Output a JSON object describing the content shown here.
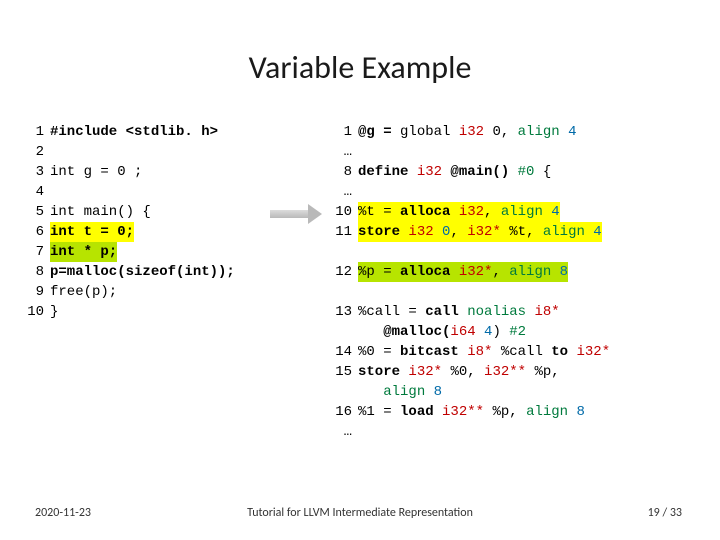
{
  "title": "Variable Example",
  "left_code": [
    {
      "n": "1",
      "cls": "",
      "t": "#include <stdlib. h>",
      "kw": true
    },
    {
      "n": "2",
      "cls": "",
      "t": ""
    },
    {
      "n": "3",
      "cls": "",
      "t": "int g = 0 ;"
    },
    {
      "n": "4",
      "cls": "",
      "t": ""
    },
    {
      "n": "5",
      "cls": "",
      "t": "int main() {"
    },
    {
      "n": "6",
      "cls": "hi-y",
      "t": "int t = 0;",
      "kw": true
    },
    {
      "n": "7",
      "cls": "hi-g",
      "t": "int * p;",
      "kw": true
    },
    {
      "n": "8",
      "cls": "",
      "t": "p=malloc(sizeof(int));",
      "kw": true
    },
    {
      "n": "9",
      "cls": "",
      "t": "free(p);"
    },
    {
      "n": "10",
      "cls": "",
      "t": "}"
    }
  ],
  "right_code": [
    {
      "n": "1",
      "seg": [
        [
          "@g = ",
          "kw"
        ],
        [
          "global ",
          ""
        ],
        [
          "i32 ",
          "type"
        ],
        [
          "0",
          ""
        ],
        [
          ", ",
          ""
        ],
        [
          "align",
          "attr"
        ],
        [
          " ",
          ""
        ],
        [
          "4",
          "num"
        ]
      ]
    },
    {
      "n": "…",
      "seg": []
    },
    {
      "n": "8",
      "seg": [
        [
          "define ",
          "kw"
        ],
        [
          "i32 ",
          "type"
        ],
        [
          "@main() ",
          "kw"
        ],
        [
          "#0 ",
          "attr"
        ],
        [
          "{",
          ""
        ]
      ]
    },
    {
      "n": "…",
      "seg": []
    },
    {
      "n": "10",
      "cls": "hi-y",
      "seg": [
        [
          "%t = ",
          ""
        ],
        [
          "alloca ",
          "kw"
        ],
        [
          "i32",
          "type"
        ],
        [
          ", ",
          ""
        ],
        [
          "align",
          "attr"
        ],
        [
          " ",
          ""
        ],
        [
          "4",
          "num"
        ]
      ]
    },
    {
      "n": "11",
      "cls": "hi-y",
      "seg": [
        [
          "store ",
          "kw"
        ],
        [
          "i32 ",
          "type"
        ],
        [
          "0",
          "num"
        ],
        [
          ", ",
          ""
        ],
        [
          "i32* ",
          "type"
        ],
        [
          "%t, ",
          ""
        ],
        [
          "align",
          "attr"
        ],
        [
          " ",
          ""
        ],
        [
          "4",
          "num"
        ]
      ]
    },
    {
      "n": "",
      "seg": []
    },
    {
      "n": "12",
      "cls": "hi-g",
      "seg": [
        [
          "%p = ",
          ""
        ],
        [
          "alloca ",
          "kw"
        ],
        [
          "i32*",
          "type"
        ],
        [
          ", ",
          ""
        ],
        [
          "align",
          "attr"
        ],
        [
          " ",
          ""
        ],
        [
          "8",
          "num"
        ]
      ]
    },
    {
      "n": "",
      "seg": []
    },
    {
      "n": "13",
      "seg": [
        [
          "%call = ",
          ""
        ],
        [
          "call ",
          "kw"
        ],
        [
          "noalias ",
          "attr"
        ],
        [
          "i8* ",
          "type"
        ],
        [
          "",
          ""
        ]
      ]
    },
    {
      "n": "",
      "seg": [
        [
          "   @malloc(",
          "kw"
        ],
        [
          "i64 ",
          "type"
        ],
        [
          "4",
          "num"
        ],
        [
          ") ",
          ""
        ],
        [
          "#2",
          "attr"
        ]
      ]
    },
    {
      "n": "14",
      "seg": [
        [
          "%0 = ",
          ""
        ],
        [
          "bitcast ",
          "kw"
        ],
        [
          "i8* ",
          "type"
        ],
        [
          "%call ",
          ""
        ],
        [
          "to ",
          "kw"
        ],
        [
          "i32*",
          "type"
        ]
      ]
    },
    {
      "n": "15",
      "seg": [
        [
          "store ",
          "kw"
        ],
        [
          "i32* ",
          "type"
        ],
        [
          "%0, ",
          ""
        ],
        [
          "i32** ",
          "type"
        ],
        [
          "%p, ",
          ""
        ]
      ]
    },
    {
      "n": "",
      "seg": [
        [
          "   ",
          ""
        ],
        [
          "align",
          "attr"
        ],
        [
          " ",
          ""
        ],
        [
          "8",
          "num"
        ]
      ]
    },
    {
      "n": "16",
      "seg": [
        [
          "%1 = ",
          ""
        ],
        [
          "load ",
          "kw"
        ],
        [
          "i32** ",
          "type"
        ],
        [
          "%p, ",
          ""
        ],
        [
          "align",
          "attr"
        ],
        [
          " ",
          ""
        ],
        [
          "8",
          "num"
        ]
      ]
    },
    {
      "n": "…",
      "seg": []
    }
  ],
  "footer": {
    "date": "2020-11-23",
    "mid": "Tutorial for LLVM Intermediate Representation",
    "page": "19",
    "sep": " / ",
    "total": "33"
  }
}
